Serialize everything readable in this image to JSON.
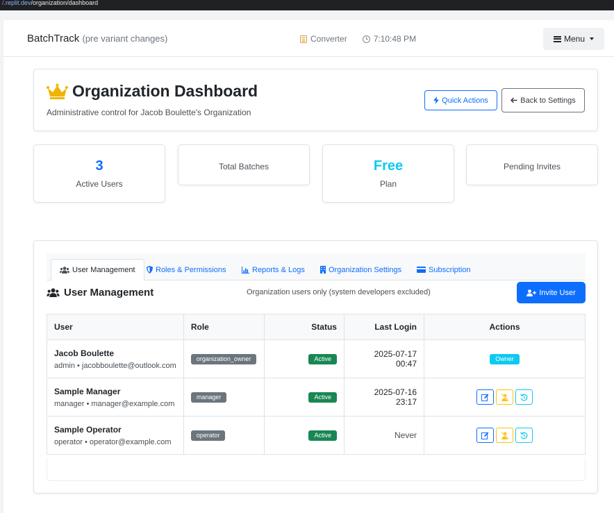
{
  "browser": {
    "url_prefix": "/",
    "url_host": ".replit.dev",
    "url_path": "/organization/dashboard"
  },
  "navbar": {
    "brand": "BatchTrack",
    "brand_sub": "(pre variant changes)",
    "converter_label": "Converter",
    "time": "7:10:48 PM",
    "menu_label": "Menu"
  },
  "header": {
    "title": "Organization Dashboard",
    "subtitle": "Administrative control for Jacob Boulette's Organization",
    "quick_actions_label": "Quick Actions",
    "back_label": "Back to Settings"
  },
  "stats": [
    {
      "value": "3",
      "label": "Active Users"
    },
    {
      "value": "",
      "label": "Total Batches"
    },
    {
      "value": "Free",
      "label": "Plan"
    },
    {
      "value": "",
      "label": "Pending Invites"
    }
  ],
  "tabs": [
    {
      "label": "User Management",
      "icon": "users-icon"
    },
    {
      "label": "Roles & Permissions",
      "icon": "shield-icon"
    },
    {
      "label": "Reports & Logs",
      "icon": "chart-icon"
    },
    {
      "label": "Organization Settings",
      "icon": "building-icon"
    },
    {
      "label": "Subscription",
      "icon": "card-icon"
    }
  ],
  "user_management": {
    "title": "User Management",
    "note": "Organization users only (system developers excluded)",
    "invite_label": "Invite User",
    "columns": [
      "User",
      "Role",
      "Status",
      "Last Login",
      "Actions"
    ],
    "rows": [
      {
        "name": "Jacob Boulette",
        "sub": "admin • jacobboulette@outlook.com",
        "role": "organization_owner",
        "status": "Active",
        "last_login": "2025-07-17 00:47",
        "owner_badge": "Owner"
      },
      {
        "name": "Sample Manager",
        "sub": "manager • manager@example.com",
        "role": "manager",
        "status": "Active",
        "last_login": "2025-07-16 23:17"
      },
      {
        "name": "Sample Operator",
        "sub": "operator • operator@example.com",
        "role": "operator",
        "status": "Active",
        "last_login": "Never"
      }
    ]
  },
  "colors": {
    "primary": "#0d6efd",
    "info": "#0dcaf0",
    "success": "#198754",
    "warning": "#ffc107",
    "secondary": "#6c757d",
    "crown": "#f0b400"
  }
}
